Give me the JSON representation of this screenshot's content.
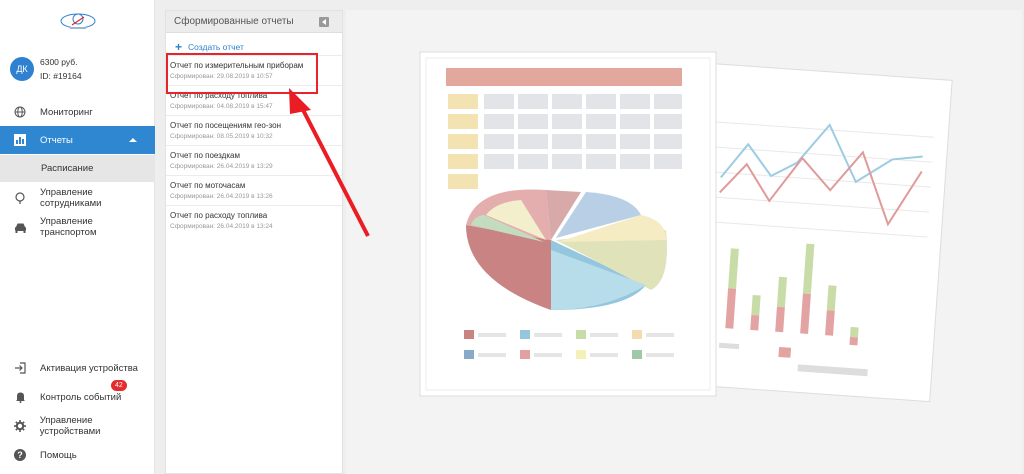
{
  "account": {
    "initials": "ДК",
    "balance": "6300 руб.",
    "id": "ID: #19164"
  },
  "nav": {
    "monitoring": "Мониторинг",
    "reports": "Отчеты",
    "schedule": "Расписание",
    "employees": "Управление сотрудниками",
    "transport": "Управление транспортом",
    "activation": "Активация устройства",
    "events": "Контроль событий",
    "events_badge": "42",
    "devices": "Управление устройствами",
    "help": "Помощь"
  },
  "panel": {
    "title": "Сформированные отчеты",
    "create": "Создать отчет",
    "reports": [
      {
        "title": "Отчет по измерительным приборам",
        "date": "Сформирован: 29.08.2019 в 10:57"
      },
      {
        "title": "Отчет по расходу топлива",
        "date": "Сформирован: 04.08.2019 в 15:47"
      },
      {
        "title": "Отчет по посещениям гео-зон",
        "date": "Сформирован: 08.05.2019 в 10:32"
      },
      {
        "title": "Отчет по поездкам",
        "date": "Сформирован: 26.04.2019 в 13:29"
      },
      {
        "title": "Отчет по моточасам",
        "date": "Сформирован: 26.04.2019 в 13:26"
      },
      {
        "title": "Отчет по расходу топлива",
        "date": "Сформирован: 26.04.2019 в 13:24"
      }
    ]
  },
  "colors": {
    "accent": "#2f87d2",
    "highlight": "#e8232a"
  }
}
